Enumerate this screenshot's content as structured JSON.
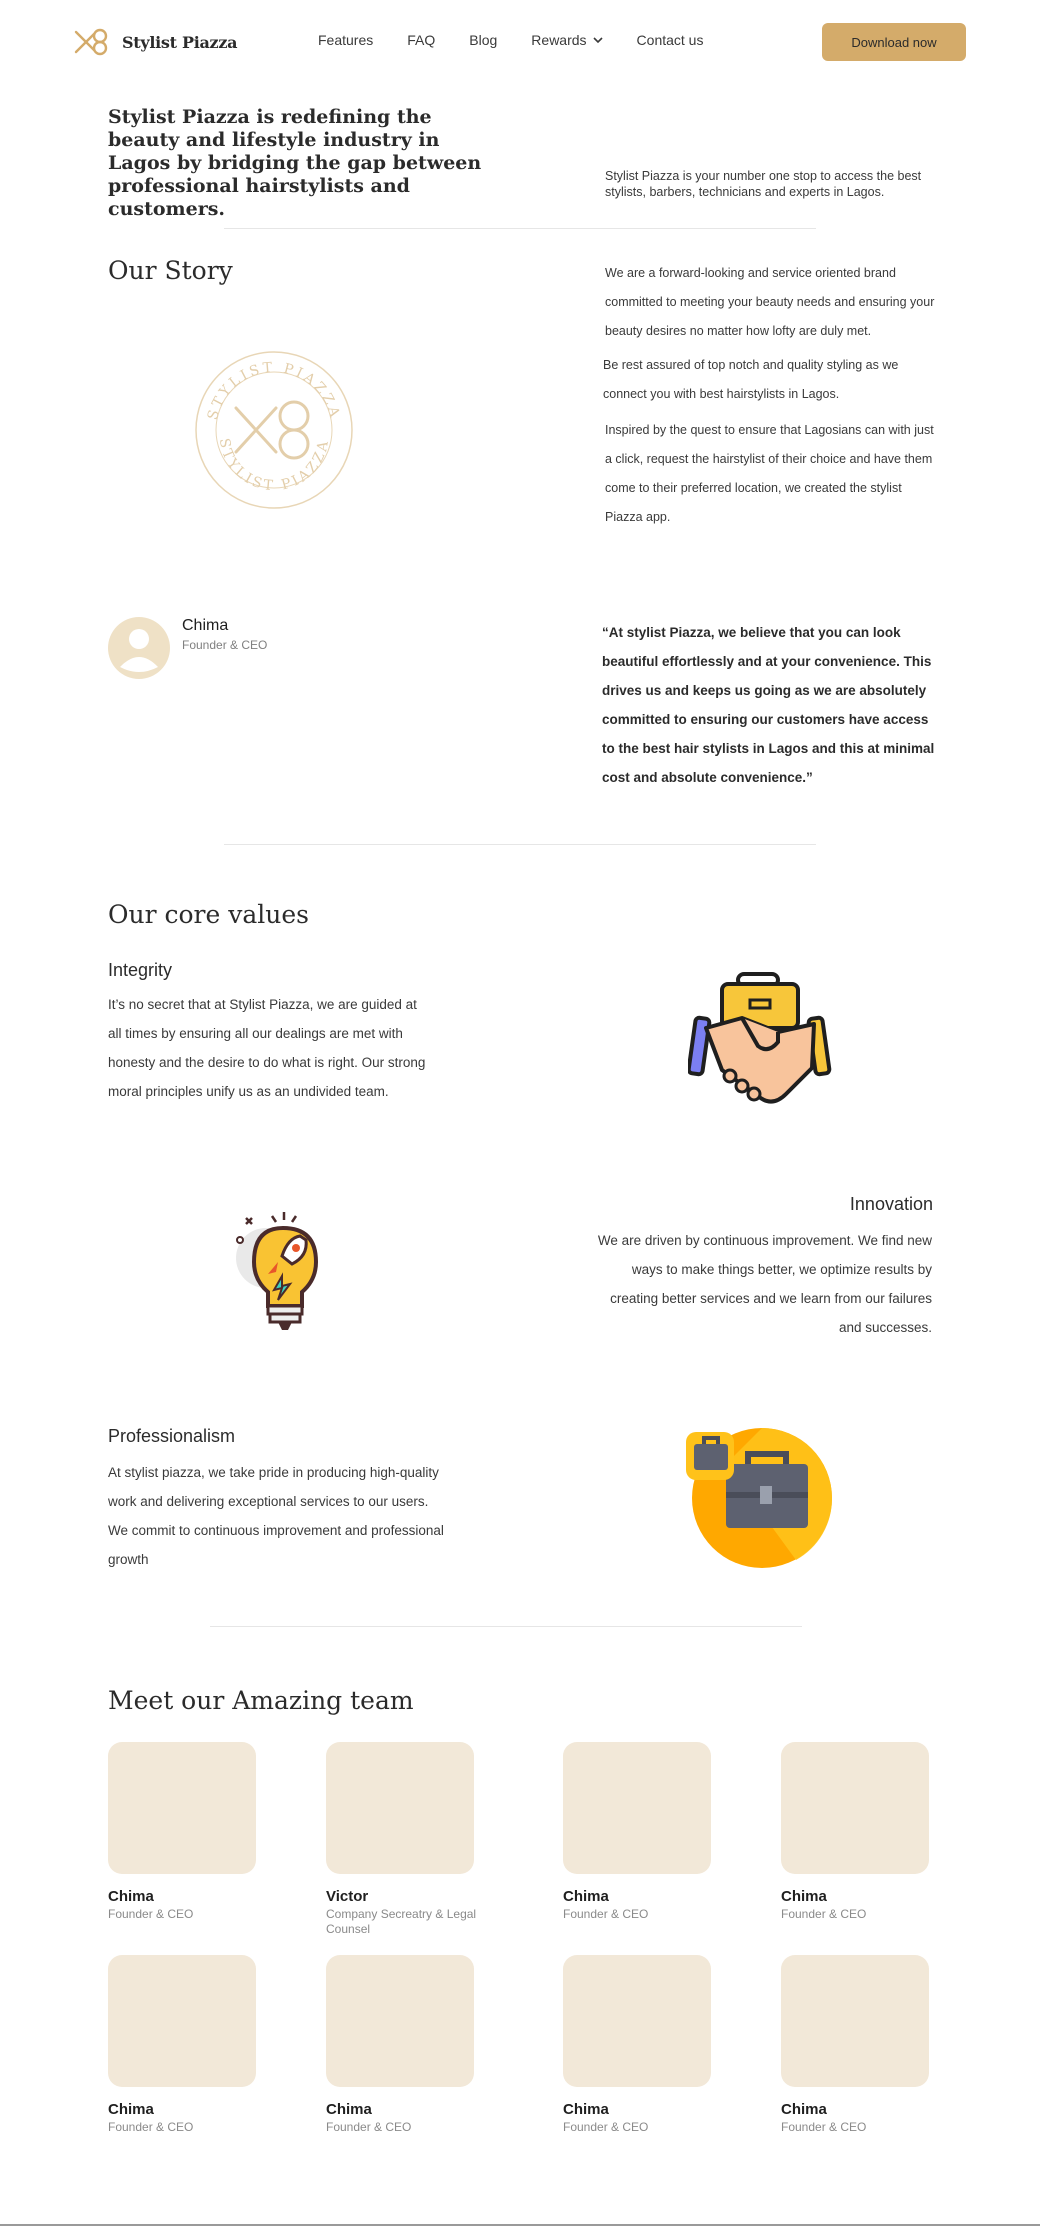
{
  "brand": {
    "name": "Stylist Piazza"
  },
  "nav": {
    "items": [
      "Features",
      "FAQ",
      "Blog",
      "Rewards",
      "Contact us"
    ],
    "download_label": "Download now"
  },
  "intro": {
    "headline": "Stylist Piazza is redefining the beauty and lifestyle industry in Lagos by bridging the gap between professional hairstylists and customers.",
    "side_text": "Stylist Piazza is your number one stop to access the best stylists, barbers, technicians and experts in Lagos."
  },
  "story": {
    "title": "Our Story",
    "seal_text": "STYLIST PIAZZA",
    "p1": "We are a forward-looking and service oriented brand committed to meeting your beauty needs and ensuring your beauty desires no matter how lofty are duly met.",
    "p2": "Be rest assured of top notch and quality styling as we connect you with best hairstylists in Lagos.",
    "p3": "Inspired by the quest to ensure that Lagosians can with just a click, request the hairstylist of their choice and have them come to their preferred location, we created the stylist",
    "p3b": "Piazza app."
  },
  "founder": {
    "name": "Chima",
    "role": "Founder & CEO",
    "quote": "“At stylist Piazza, we believe that you can look beautiful effortlessly and at your convenience. This drives us and keeps us going as we are absolutely committed to ensuring our customers have access to the best hair stylists in Lagos and this at minimal cost and absolute convenience.”"
  },
  "values": {
    "title": "Our core values",
    "integrity": {
      "title": "Integrity",
      "text": "It’s no secret that at Stylist Piazza, we are guided at all times by ensuring all our dealings are met with honesty and the desire to do what is right. Our strong moral principles unify us as an undivided team.",
      "icon": "handshake-icon"
    },
    "innovation": {
      "title": "Innovation",
      "text": "We are driven by continuous improvement. We find new ways to make  things better, we optimize results by creating better services and we learn from our  failures and successes.",
      "icon": "lightbulb-rocket-icon"
    },
    "professionalism": {
      "title": "Professionalism",
      "text": " At stylist piazza, we take pride in producing high-quality work and delivering exceptional services to our users. We commit to continuous improvement and professional growth",
      "icon": "briefcase-icon"
    }
  },
  "team": {
    "title": "Meet our Amazing team",
    "members": [
      {
        "name": "Chima",
        "role": "Founder & CEO"
      },
      {
        "name": "Victor",
        "role": "Company Secreatry & Legal Counsel"
      },
      {
        "name": "Chima",
        "role": "Founder & CEO"
      },
      {
        "name": "Chima",
        "role": "Founder & CEO"
      },
      {
        "name": "Chima",
        "role": "Founder & CEO"
      },
      {
        "name": "Chima",
        "role": "Founder & CEO"
      },
      {
        "name": "Chima",
        "role": "Founder & CEO"
      },
      {
        "name": "Chima",
        "role": "Founder & CEO"
      }
    ]
  },
  "colors": {
    "accent": "#d4ab6a",
    "card": "#f2e8d8",
    "avatar": "#efe1c6"
  }
}
